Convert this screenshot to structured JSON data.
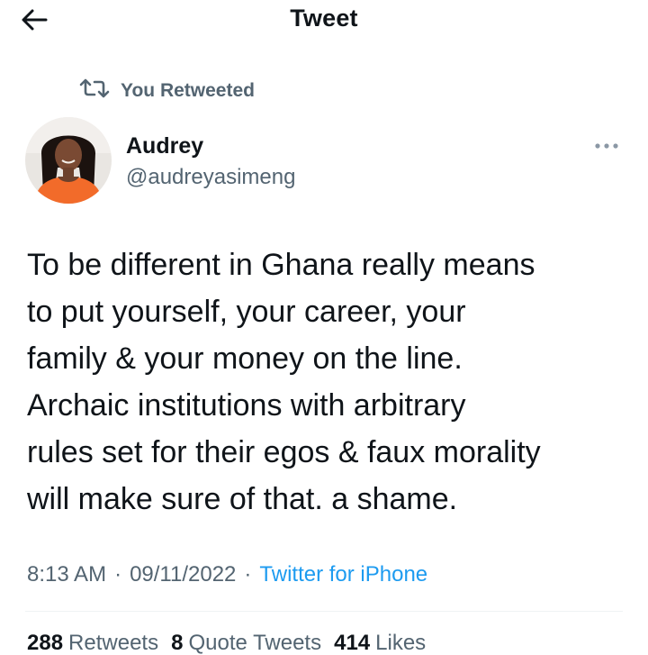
{
  "header": {
    "title": "Tweet",
    "back_icon": "arrow-left-icon"
  },
  "social_context": {
    "label": "You Retweeted",
    "icon": "retweet-icon"
  },
  "author": {
    "display_name": "Audrey",
    "handle": "@audreyasimeng",
    "more_icon": "more-horizontal-icon"
  },
  "tweet": {
    "lines": [
      "To be different in Ghana really means",
      "to put yourself, your career, your",
      "family & your money on the line.",
      "Archaic institutions with arbitrary",
      "rules set for their egos & faux morality",
      "will make sure of that. a shame."
    ]
  },
  "meta": {
    "time": "8:13 AM",
    "separator": "·",
    "date": "09/11/2022",
    "source": "Twitter for iPhone"
  },
  "stats": {
    "retweets_count": "288",
    "retweets_label": "Retweets",
    "quotes_count": "8",
    "quotes_label": "Quote Tweets",
    "likes_count": "414",
    "likes_label": "Likes"
  },
  "colors": {
    "text_primary": "#0f1419",
    "text_secondary": "#536471",
    "link": "#1d9bf0",
    "divider": "#eff3f4"
  }
}
